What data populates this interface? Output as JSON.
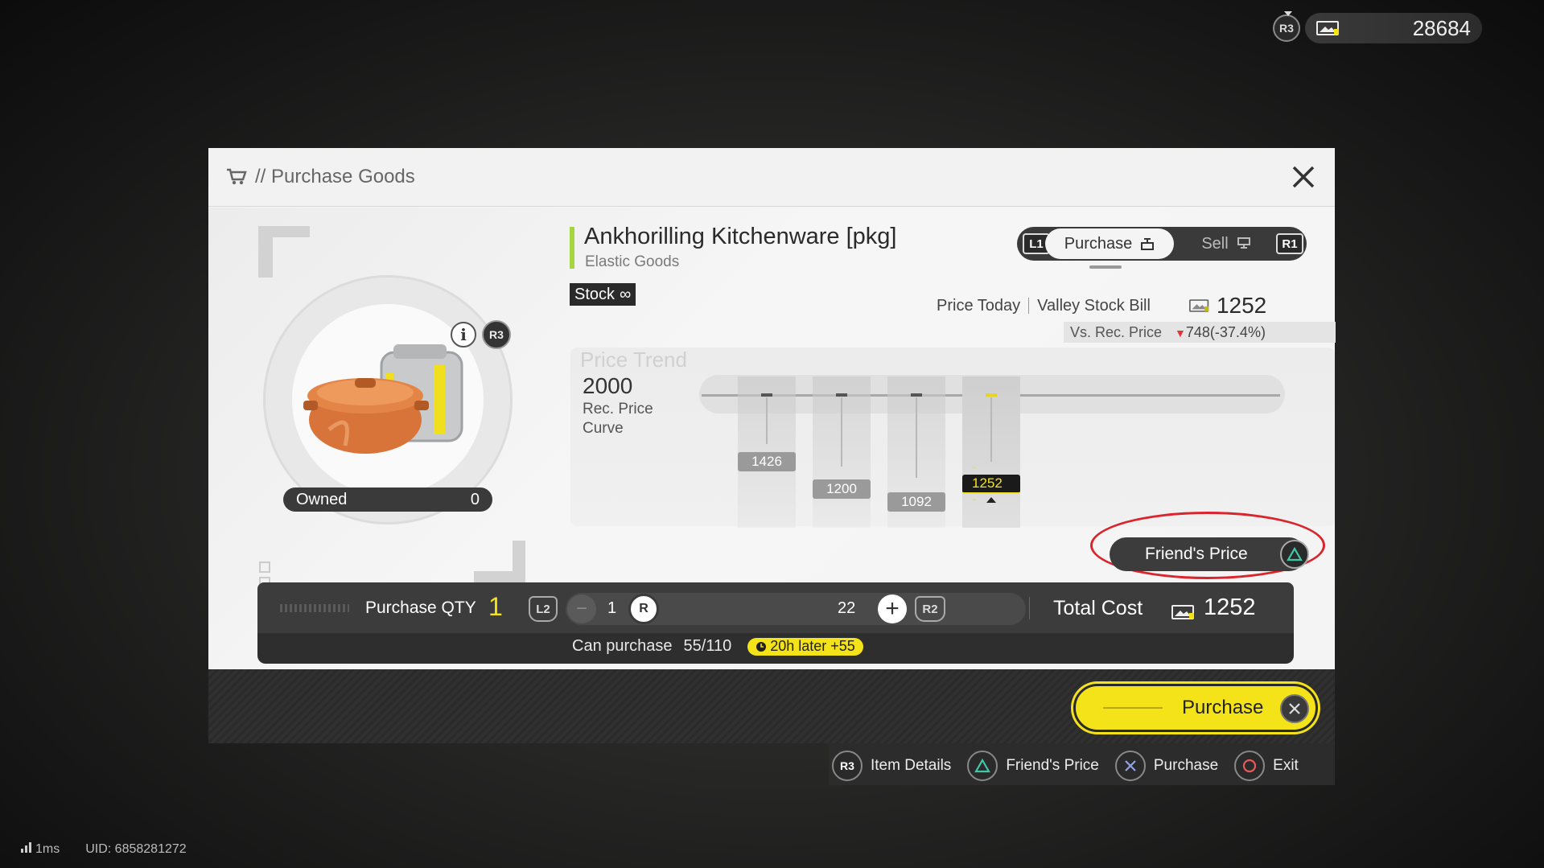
{
  "top_bar": {
    "button_badge": "R3",
    "currency_amount": "28684"
  },
  "dialog": {
    "title": "// Purchase Goods",
    "item": {
      "name": "Ankhorilling Kitchenware [pkg]",
      "category": "Elastic Goods",
      "stock_label": "Stock",
      "stock_value": "∞",
      "info_button": "i",
      "details_badge": "R3",
      "owned_label": "Owned",
      "owned_value": "0"
    },
    "mode_toggle": {
      "left_badge": "L1",
      "purchase_label": "Purchase",
      "sell_label": "Sell",
      "right_badge": "R1",
      "selected": "Purchase"
    },
    "pricing": {
      "price_today_label": "Price Today",
      "bill_label": "Valley Stock Bill",
      "price_today_value": "1252",
      "vs_label": "Vs. Rec. Price",
      "vs_value": "748(-37.4%)"
    },
    "trend": {
      "title": "Price Trend",
      "rec_price": "2000",
      "rec_label_line1": "Rec. Price",
      "rec_label_line2": "Curve",
      "points": [
        {
          "label": "1426"
        },
        {
          "label": "1200"
        },
        {
          "label": "1092"
        },
        {
          "label": "- 1252 -",
          "current": true
        }
      ]
    },
    "friend_price": {
      "label": "Friend's Price"
    },
    "quantity": {
      "label": "Purchase QTY",
      "value": "1",
      "l2_badge": "L2",
      "min_symbol": "−",
      "slider_value": "1",
      "thumb_label": "R",
      "max_value": "22",
      "plus_symbol": "+",
      "r2_badge": "R2",
      "total_label": "Total Cost",
      "total_value": "1252",
      "can_purchase_label": "Can purchase",
      "can_purchase_value": "55/110",
      "refill_label": "20h later +55"
    }
  },
  "purchase_button": {
    "label": "Purchase"
  },
  "hints": [
    {
      "badge": "R3",
      "label": "Item Details",
      "icon": "r3-icon"
    },
    {
      "badge": "",
      "label": "Friend's Price",
      "icon": "triangle-icon"
    },
    {
      "badge": "",
      "label": "Purchase",
      "icon": "cross-icon"
    },
    {
      "badge": "",
      "label": "Exit",
      "icon": "circle-icon"
    }
  ],
  "footer": {
    "latency": "1ms",
    "uid": "UID: 6858281272"
  },
  "colors": {
    "accent_yellow": "#f5e31a",
    "name_bar_green": "#a5d63f",
    "highlight_red": "#d9252d",
    "down_red": "#e03535"
  }
}
